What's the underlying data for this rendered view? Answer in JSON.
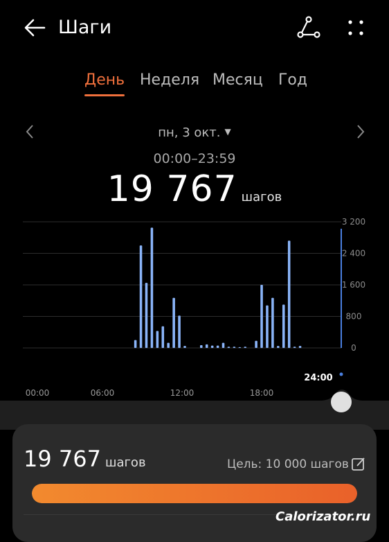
{
  "header": {
    "title": "Шаги",
    "back_icon": "arrow-left-icon",
    "share_icon": "share-icon",
    "more_icon": "more-vertical-icon"
  },
  "tabs": [
    {
      "label": "День",
      "active": true
    },
    {
      "label": "Неделя",
      "active": false
    },
    {
      "label": "Месяц",
      "active": false
    },
    {
      "label": "Год",
      "active": false
    }
  ],
  "date": {
    "label": "пн, 3 окт.",
    "caret": "▼",
    "time_range": "00:00–23:59"
  },
  "summary": {
    "steps": "19 767",
    "unit": "шагов"
  },
  "colors": {
    "accent": "#f0703c",
    "bar": "#8ab4f8",
    "bar_selected": "#4a7fe0",
    "card": "#2b2b2b"
  },
  "chart_data": {
    "type": "bar",
    "x_tick_labels": [
      "00:00",
      "06:00",
      "12:00",
      "18:00",
      "24:00"
    ],
    "y_tick_labels": [
      "3 200",
      "2 400",
      "1 600",
      "800",
      "0"
    ],
    "ylim": [
      0,
      3200
    ],
    "bin_minutes": 30,
    "values": [
      0,
      0,
      0,
      0,
      0,
      0,
      0,
      0,
      0,
      0,
      0,
      0,
      0,
      0,
      0,
      0,
      0,
      0,
      0,
      0,
      200,
      2600,
      1650,
      3050,
      430,
      550,
      130,
      1270,
      820,
      50,
      0,
      0,
      70,
      90,
      60,
      60,
      130,
      30,
      30,
      20,
      30,
      0,
      180,
      1600,
      1080,
      1270,
      50,
      1100,
      2720,
      30,
      50,
      0,
      0,
      0,
      0,
      0,
      0,
      0
    ],
    "grid": true,
    "legend": "none"
  },
  "card": {
    "steps": "19 767",
    "unit": "шагов",
    "goal_label": "Цель: 10 000 шагов",
    "goal_progress": 1.0,
    "edit_icon": "edit-icon"
  },
  "watermark": "Calorizator.ru"
}
